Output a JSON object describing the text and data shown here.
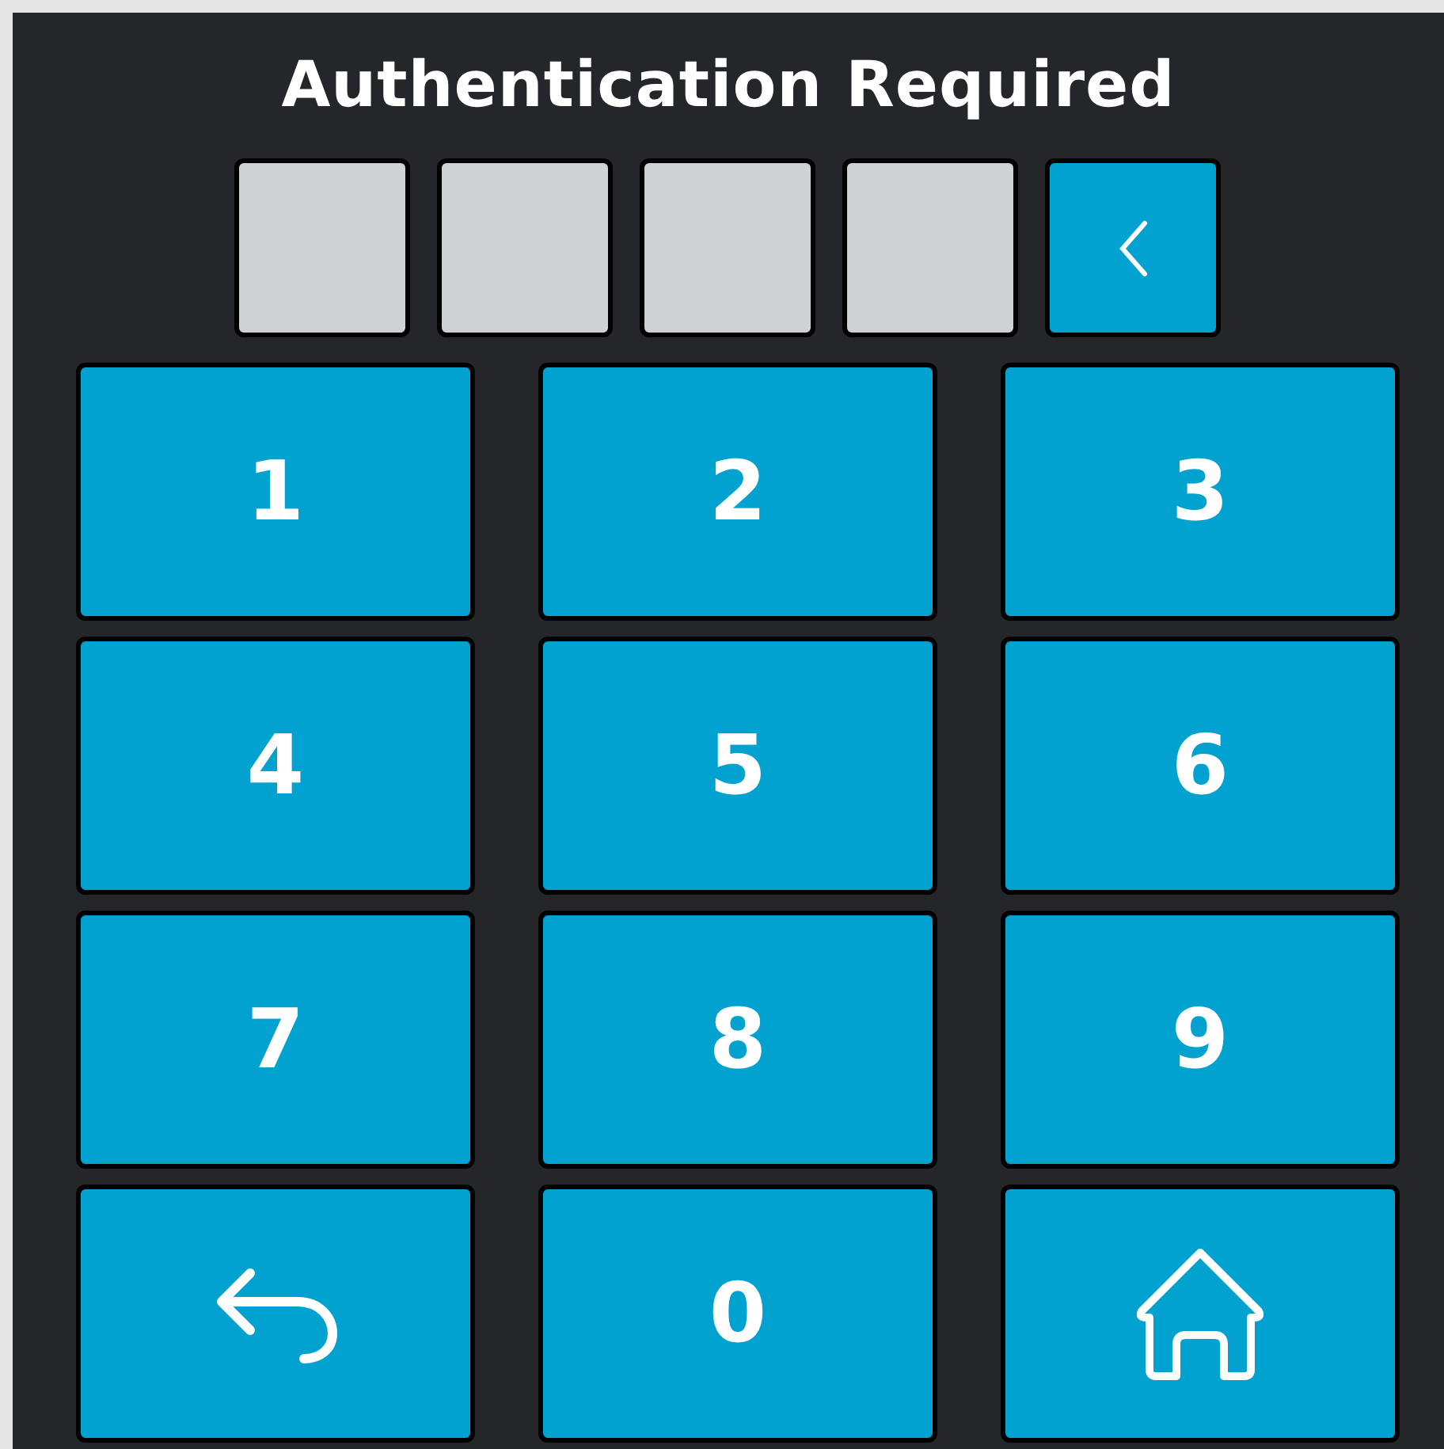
{
  "title": "Authentication Required",
  "pin_slots": [
    {
      "filled": false
    },
    {
      "filled": false
    },
    {
      "filled": false
    },
    {
      "filled": false
    }
  ],
  "keys": [
    {
      "kind": "digit",
      "label": "1"
    },
    {
      "kind": "digit",
      "label": "2"
    },
    {
      "kind": "digit",
      "label": "3"
    },
    {
      "kind": "digit",
      "label": "4"
    },
    {
      "kind": "digit",
      "label": "5"
    },
    {
      "kind": "digit",
      "label": "6"
    },
    {
      "kind": "digit",
      "label": "7"
    },
    {
      "kind": "digit",
      "label": "8"
    },
    {
      "kind": "digit",
      "label": "9"
    },
    {
      "kind": "back"
    },
    {
      "kind": "digit",
      "label": "0"
    },
    {
      "kind": "home"
    }
  ]
}
